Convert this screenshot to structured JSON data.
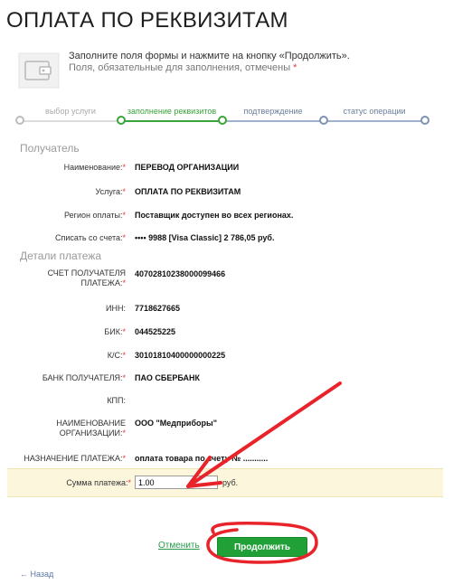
{
  "page": {
    "title": "ОПЛАТА ПО РЕКВИЗИТАМ"
  },
  "hint": {
    "line1": "Заполните поля формы и нажмите на кнопку «Продолжить».",
    "line2": "Поля, обязательные для заполнения, отмечены",
    "required_mark": "*"
  },
  "steps": [
    {
      "label": "выбор услуги",
      "state": "done"
    },
    {
      "label": "заполнение реквизитов",
      "state": "active"
    },
    {
      "label": "подтверждение",
      "state": "next"
    },
    {
      "label": "статус операции",
      "state": "next"
    }
  ],
  "recipient": {
    "heading": "Получатель",
    "fields": [
      {
        "label": "Наименование:",
        "value": "ПЕРЕВОД ОРГАНИЗАЦИИ"
      },
      {
        "label": "Услуга:",
        "value": "ОПЛАТА ПО РЕКВИЗИТАМ"
      },
      {
        "label": "Регион оплаты:",
        "value": "Поставщик доступен во всех регионах."
      },
      {
        "label": "Списать со счета:",
        "value": "•••• 9988  [Visa Classic] 2 786,05   руб."
      }
    ]
  },
  "details": {
    "heading": "Детали платежа",
    "account_label": "СЧЕТ ПОЛУЧАТЕЛЯ ПЛАТЕЖА:",
    "account_value": "40702810238000099466",
    "inn_label": "ИНН:",
    "inn_value": "7718627665",
    "bik_label": "БИК:",
    "bik_value": "044525225",
    "ks_label": "К/С:",
    "ks_value": "30101810400000000225",
    "bank_label": "БАНК ПОЛУЧАТЕЛЯ:",
    "bank_value": "ПАО СБЕРБАНК",
    "kpp_label": "КПП:",
    "kpp_value": "",
    "org_label": "НАИМЕНОВАНИЕ ОРГАНИЗАЦИИ:",
    "org_value": "ООО \"Медприборы\"",
    "purpose_label": "НАЗНАЧЕНИЕ ПЛАТЕЖА:",
    "purpose_value": "оплата товара по счету № ...........",
    "amount_label": "Сумма платежа:",
    "amount_value": "1.00",
    "amount_currency": "руб."
  },
  "actions": {
    "cancel": "Отменить",
    "continue": "Продолжить",
    "back": "Назад"
  },
  "colors": {
    "accent_green": "#21a038",
    "annotation_red": "#e8232a",
    "amount_highlight": "#fbf6dc"
  }
}
